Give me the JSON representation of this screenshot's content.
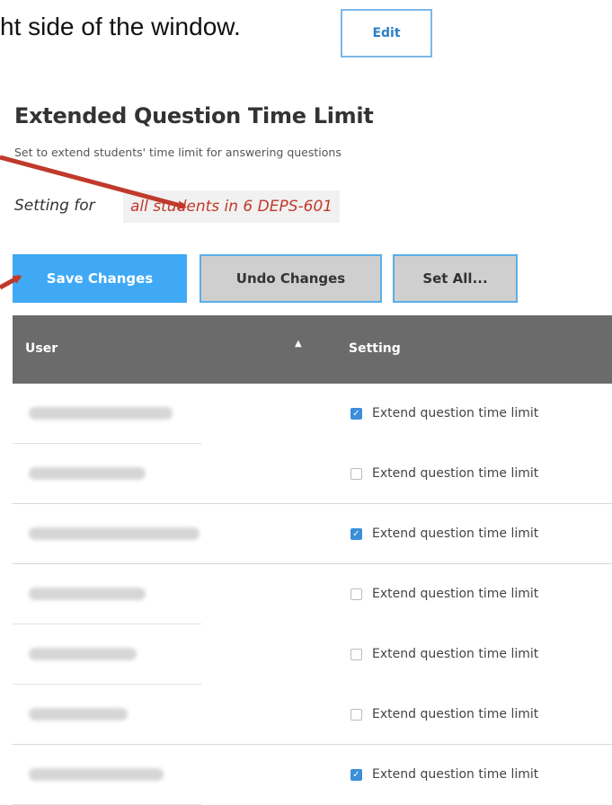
{
  "top_text": "ht side of the window.",
  "edit_label": "Edit",
  "heading": "Extended Question Time Limit",
  "subheading": "Set to extend students' time limit for answering questions",
  "setting_for_label": "Setting for",
  "setting_for_value": "all students in 6 DEPS-601",
  "buttons": {
    "save": "Save Changes",
    "undo": "Undo Changes",
    "set_all": "Set All..."
  },
  "table": {
    "col_user": "User",
    "sort_icon": "▲",
    "col_setting": "Setting",
    "rows": [
      {
        "checked": true,
        "label": "Extend question time limit"
      },
      {
        "checked": false,
        "label": "Extend question time limit"
      },
      {
        "checked": true,
        "label": "Extend question time limit"
      },
      {
        "checked": false,
        "label": "Extend question time limit"
      },
      {
        "checked": false,
        "label": "Extend question time limit"
      },
      {
        "checked": false,
        "label": "Extend question time limit"
      },
      {
        "checked": true,
        "label": "Extend question time limit"
      }
    ]
  },
  "colors": {
    "accent": "#3fa9f5",
    "arrow": "#c0392b",
    "header_bg": "#6b6b6b"
  }
}
